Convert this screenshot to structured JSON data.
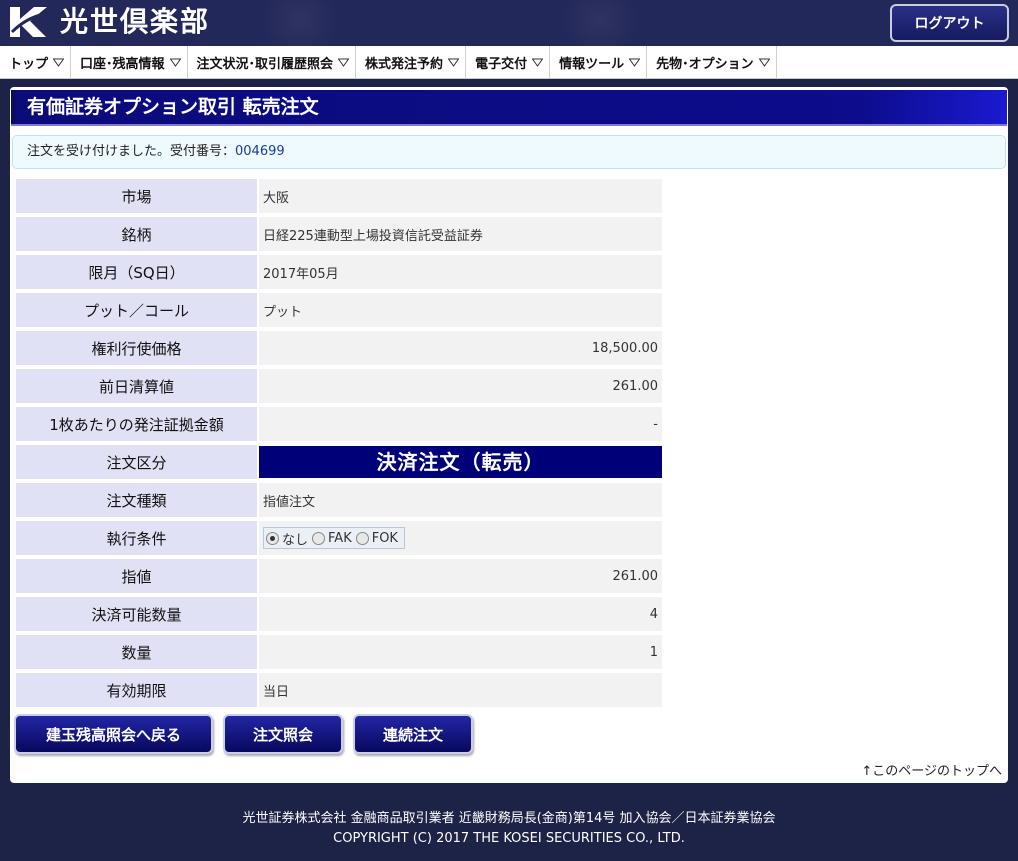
{
  "header": {
    "logo_mark": "K",
    "logo_text": "光世倶楽部",
    "logout_label": "ログアウト"
  },
  "nav": {
    "items": [
      {
        "label": "トップ"
      },
      {
        "label": "口座･残高情報"
      },
      {
        "label": "注文状況･取引履歴照会"
      },
      {
        "label": "株式発注予約"
      },
      {
        "label": "電子交付"
      },
      {
        "label": "情報ツール"
      },
      {
        "label": "先物･オプション"
      }
    ]
  },
  "page": {
    "title": "有価証券オプション取引  転売注文",
    "notice_prefix": "注文を受け付けました。受付番号：",
    "notice_number": "004699"
  },
  "details": {
    "market": {
      "label": "市場",
      "value": "大阪"
    },
    "issue": {
      "label": "銘柄",
      "value": "日経225連動型上場投資信託受益証券"
    },
    "contract_month": {
      "label": "限月（SQ日）",
      "value": "2017年05月"
    },
    "put_call": {
      "label": "プット／コール",
      "value": "プット"
    },
    "strike_price": {
      "label": "権利行使価格",
      "value": "18,500.00"
    },
    "prev_settlement": {
      "label": "前日清算値",
      "value": "261.00"
    },
    "margin_per_unit": {
      "label": "1枚あたりの発注証拠金額",
      "value": "-"
    },
    "order_class": {
      "label": "注文区分",
      "value": "決済注文（転売）"
    },
    "order_type": {
      "label": "注文種類",
      "value": "指値注文"
    },
    "exec_condition": {
      "label": "執行条件",
      "options": [
        "なし",
        "FAK",
        "FOK"
      ],
      "selected": "なし"
    },
    "limit_price": {
      "label": "指値",
      "value": "261.00"
    },
    "settle_qty": {
      "label": "決済可能数量",
      "value": "4"
    },
    "quantity": {
      "label": "数量",
      "value": "1"
    },
    "validity": {
      "label": "有効期限",
      "value": "当日"
    }
  },
  "buttons": {
    "back_label": "建玉残高照会へ戻る",
    "order_inquiry_label": "注文照会",
    "continuous_label": "連続注文"
  },
  "page_top_link": "↑このページのトップへ",
  "footer": {
    "line1": "光世証券株式会社  金融商品取引業者  近畿財務局長(金商)第14号  加入協会／日本証券業協会",
    "line2": "COPYRIGHT (C) 2017 THE KOSEI SECURITIES CO., LTD."
  },
  "colors": {
    "brand_navy": "#23285a",
    "title_bar": "#0b0b7a",
    "label_cell": "#e1e1f5",
    "value_cell": "#f2f2f2"
  }
}
